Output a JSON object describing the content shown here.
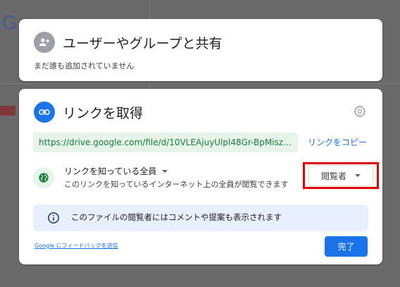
{
  "background": {
    "logo_text": "G"
  },
  "share_panel": {
    "title": "ユーザーやグループと共有",
    "subtitle": "まだ誰も追加されていません",
    "icon": "add-person-icon"
  },
  "link_panel": {
    "title": "リンクを取得",
    "icon": "link-icon",
    "url": "https://drive.google.com/file/d/10VLEAjuyUlpl48Gr-BpMiszoMESc5e...",
    "copy_label": "リンクをコピー",
    "access_title": "リンクを知っている全員",
    "access_description": "このリンクを知っているインターネット上の全員が閲覧できます",
    "role_value": "閲覧者",
    "info_text": "このファイルの閲覧者にはコメントや提案も表示されます",
    "feedback_label": "Google にフィードバックを送信",
    "done_label": "完了"
  },
  "colors": {
    "accent": "#1a73e8",
    "url_bg": "#e6f4ea",
    "url_text": "#188038",
    "info_bg": "#e8f0fe",
    "highlight": "#e00000"
  }
}
